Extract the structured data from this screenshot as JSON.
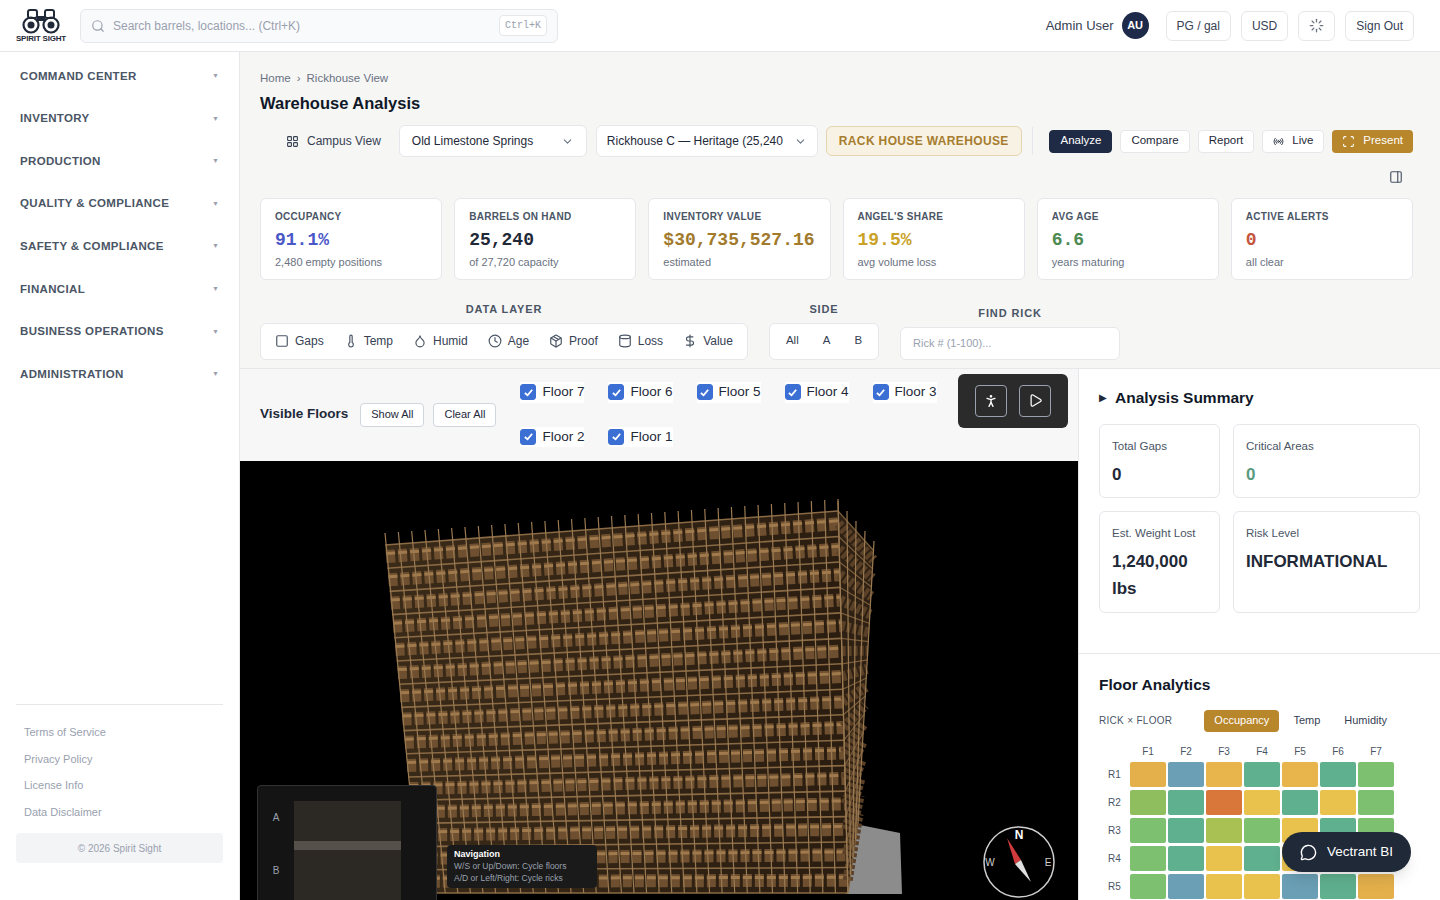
{
  "brand": {
    "name": "SPIRIT SIGHT"
  },
  "search": {
    "placeholder": "Search barrels, locations... (Ctrl+K)",
    "shortcut": "Ctrl+K"
  },
  "user": {
    "name": "Admin User",
    "initials": "AU"
  },
  "header_buttons": [
    "PG / gal",
    "USD"
  ],
  "sign_out": "Sign Out",
  "sidebar": {
    "items": [
      {
        "label": "COMMAND CENTER",
        "caret": "▼",
        "expanded": false
      },
      {
        "label": "INVENTORY",
        "caret": "▼",
        "expanded": false
      },
      {
        "label": "PRODUCTION",
        "caret": "▼",
        "expanded": false
      },
      {
        "label": "QUALITY & COMPLIANCE",
        "caret": "▼",
        "expanded": false
      },
      {
        "label": "SAFETY & COMPLIANCE",
        "caret": "▼",
        "expanded": false
      },
      {
        "label": "FINANCIAL",
        "caret": "▼",
        "expanded": false
      },
      {
        "label": "BUSINESS OPERATIONS",
        "caret": "▼",
        "expanded": false
      },
      {
        "label": "ADMINISTRATION",
        "caret": "▼",
        "expanded": false
      }
    ],
    "footer_links": [
      "Terms of Service",
      "Privacy Policy",
      "License Info",
      "Data Disclaimer"
    ],
    "copyright": "© 2026 Spirit Sight"
  },
  "breadcrumb": {
    "items": [
      "Home",
      "Rickhouse View"
    ],
    "separator": "›"
  },
  "page_title": "Warehouse Analysis",
  "toolbar": {
    "campus_view": "Campus View",
    "campus_select": "Old Limestone Springs",
    "house_select": "Rickhouse C — Heritage (25,240",
    "house_type": "RACK HOUSE WAREHOUSE",
    "modes": [
      {
        "label": "Analyze",
        "selected": true
      },
      {
        "label": "Compare",
        "selected": false
      },
      {
        "label": "Report",
        "selected": false
      },
      {
        "label": "Live",
        "selected": false
      }
    ],
    "present": "Present"
  },
  "kpis": [
    {
      "label": "OCCUPANCY",
      "value": "91.1%",
      "sub": "2,480 empty positions",
      "color": "#4a58c8"
    },
    {
      "label": "BARRELS ON HAND",
      "value": "25,240",
      "sub": "of 27,720 capacity",
      "color": "#1f2937"
    },
    {
      "label": "INVENTORY VALUE",
      "value": "$30,735,527.16",
      "sub": "estimated",
      "color": "#a27a2c"
    },
    {
      "label": "ANGEL'S SHARE",
      "value": "19.5%",
      "sub": "avg volume loss",
      "color": "#c9a227"
    },
    {
      "label": "AVG AGE",
      "value": "6.6",
      "sub": "years maturing",
      "color": "#4d8a52"
    },
    {
      "label": "ACTIVE ALERTS",
      "value": "0",
      "sub": "all clear",
      "color": "#c4553d"
    }
  ],
  "data_layer": {
    "title": "DATA LAYER",
    "items": [
      {
        "label": "Gaps",
        "selected": false
      },
      {
        "label": "Temp",
        "selected": false
      },
      {
        "label": "Humid",
        "selected": false
      },
      {
        "label": "Age",
        "selected": false
      },
      {
        "label": "Proof",
        "selected": false
      },
      {
        "label": "Loss",
        "selected": false
      },
      {
        "label": "Value",
        "selected": false
      }
    ]
  },
  "side": {
    "title": "SIDE",
    "options": [
      {
        "label": "All",
        "selected": false
      },
      {
        "label": "A",
        "selected": false
      },
      {
        "label": "B",
        "selected": false
      }
    ]
  },
  "find_rick": {
    "title": "FIND RICK",
    "placeholder": "Rick # (1-100)..."
  },
  "floors": {
    "title": "Visible Floors",
    "show_all": "Show All",
    "clear_all": "Clear All",
    "items": [
      {
        "label": "Floor 7",
        "checked": true
      },
      {
        "label": "Floor 6",
        "checked": true
      },
      {
        "label": "Floor 5",
        "checked": true
      },
      {
        "label": "Floor 4",
        "checked": true
      },
      {
        "label": "Floor 3",
        "checked": true
      },
      {
        "label": "Floor 2",
        "checked": true
      },
      {
        "label": "Floor 1",
        "checked": true
      }
    ]
  },
  "view": {
    "minimap": {
      "labels": [
        "A",
        "B"
      ]
    },
    "navigation": {
      "title": "Navigation",
      "lines": [
        "W/S or Up/Down: Cycle floors",
        "A/D or Left/Right: Cycle ricks"
      ]
    },
    "compass": {
      "north": "N",
      "west": "W",
      "east": "E"
    }
  },
  "summary": {
    "toggle": "▶",
    "title": "Analysis Summary",
    "cards": [
      {
        "label": "Total Gaps",
        "value": "0",
        "color": "#1f2937"
      },
      {
        "label": "Critical Areas",
        "value": "0",
        "color": "#5a9a7e"
      },
      {
        "label": "Est. Weight Lost",
        "value": "1,240,000 lbs",
        "color": "#1f2937"
      },
      {
        "label": "Risk Level",
        "value": "INFORMATIONAL",
        "color": "#1f2937"
      }
    ]
  },
  "floor_analytics": {
    "title": "Floor Analytics",
    "axis_label": "RICK × FLOOR",
    "tabs": [
      {
        "label": "Occupancy",
        "selected": true
      },
      {
        "label": "Temp",
        "selected": false
      },
      {
        "label": "Humidity",
        "selected": false
      }
    ],
    "columns": [
      "F1",
      "F2",
      "F3",
      "F4",
      "F5",
      "F6",
      "F7"
    ],
    "rows": [
      {
        "label": "R1",
        "cells": [
          {
            "color": "#e3b04b"
          },
          {
            "color": "#6a9fb5"
          },
          {
            "color": "#e8b44c"
          },
          {
            "color": "#5fb08e"
          },
          {
            "color": "#e8b44c"
          },
          {
            "color": "#5fb08e"
          },
          {
            "color": "#7cc070"
          }
        ]
      },
      {
        "label": "R2",
        "cells": [
          {
            "color": "#8fbe5f"
          },
          {
            "color": "#5fb08e"
          },
          {
            "color": "#d9773a"
          },
          {
            "color": "#e9c24e"
          },
          {
            "color": "#5fb08e"
          },
          {
            "color": "#e9c24e"
          },
          {
            "color": "#7cc070"
          }
        ]
      },
      {
        "label": "R3",
        "cells": [
          {
            "color": "#7cc070"
          },
          {
            "color": "#5fb08e"
          },
          {
            "color": "#a9c052"
          },
          {
            "color": "#7cc070"
          },
          {
            "color": "#e9c24e"
          },
          {
            "color": "#5fb08e"
          },
          {
            "color": "#7cc070"
          }
        ]
      },
      {
        "label": "R4",
        "cells": [
          {
            "color": "#7cc070"
          },
          {
            "color": "#5fb08e"
          },
          {
            "color": "#e9c24e"
          },
          {
            "color": "#5fb08e"
          },
          {
            "color": "#e9c24e"
          },
          {
            "color": "#5fb08e"
          },
          {
            "color": "#7cc070"
          }
        ]
      },
      {
        "label": "R5",
        "cells": [
          {
            "color": "#7cc070"
          },
          {
            "color": "#6a9fb5"
          },
          {
            "color": "#e9c24e"
          },
          {
            "color": "#e9c24e"
          },
          {
            "color": "#6a9fb5"
          },
          {
            "color": "#5fb08e"
          },
          {
            "color": "#e3b04b"
          }
        ]
      }
    ]
  },
  "assistant": {
    "label": "Vectrant BI"
  }
}
